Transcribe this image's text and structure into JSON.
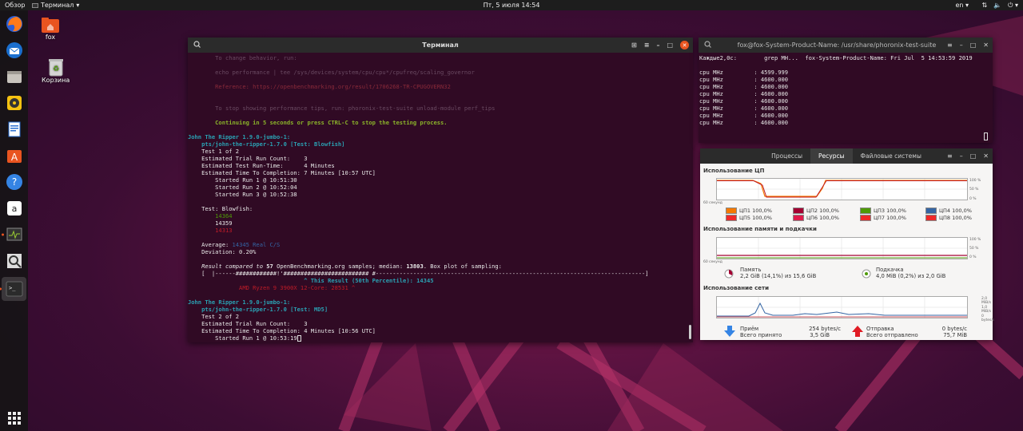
{
  "topbar": {
    "overview": "Обзор",
    "app": "Терминал",
    "clock": "Пт, 5 июля  14:54",
    "lang": "en"
  },
  "desktop": {
    "home_label": "fox",
    "trash_label": "Корзина"
  },
  "terminal": {
    "title": "Терминал",
    "lines": [
      {
        "t": "        To change behavior, run:",
        "c": "dim"
      },
      {
        "t": "",
        "c": ""
      },
      {
        "t": "        echo performance | tee /sys/devices/system/cpu/cpu*/cpufreq/scaling_governor",
        "c": "dim"
      },
      {
        "t": "",
        "c": ""
      },
      {
        "t": "        Reference: https://openbenchmarking.org/result/1706268-TR-CPUGOVERN32",
        "c": "dimred"
      },
      {
        "t": "",
        "c": ""
      },
      {
        "t": "",
        "c": ""
      },
      {
        "t": "        To stop showing performance tips, run: phoronix-test-suite unload-module perf_tips",
        "c": "dim"
      },
      {
        "t": "",
        "c": ""
      },
      {
        "t": "        Continuing in 5 seconds or press CTRL-C to stop the testing process.",
        "c": "green"
      },
      {
        "t": "",
        "c": ""
      },
      {
        "t": "John The Ripper 1.9.0-jumbo-1:",
        "c": "cyanb"
      },
      {
        "t": "    pts/john-the-ripper-1.7.0 [Test: Blowfish]",
        "c": "cyanb"
      },
      {
        "t": "    Test 1 of 2",
        "c": ""
      },
      {
        "t": "    Estimated Trial Run Count:    3",
        "c": ""
      },
      {
        "t": "    Estimated Test Run-Time:      4 Minutes",
        "c": ""
      },
      {
        "t": "    Estimated Time To Completion: 7 Minutes [10:57 UTC]",
        "c": ""
      },
      {
        "t": "        Started Run 1 @ 10:51:30",
        "c": ""
      },
      {
        "t": "        Started Run 2 @ 10:52:04",
        "c": ""
      },
      {
        "t": "        Started Run 3 @ 10:52:38",
        "c": ""
      },
      {
        "t": "",
        "c": ""
      },
      {
        "t": "    Test: Blowfish:",
        "c": ""
      },
      {
        "t": "        14364",
        "c": "green2"
      },
      {
        "t": "        14359",
        "c": ""
      },
      {
        "t": "        14313",
        "c": "red"
      },
      {
        "t": "",
        "c": ""
      },
      {
        "t": "    Average: 14345 Real C/S",
        "c": "avg"
      },
      {
        "t": "    Deviation: 0.20%",
        "c": ""
      },
      {
        "t": "",
        "c": ""
      },
      {
        "t": "    Result compared to 57 OpenBenchmarking.org samples; median: 13803. Box plot of sampling:",
        "c": "cmp"
      },
      {
        "t": "    [  |------############!'######################### #-------------------------------------------------------------------------------]",
        "c": ""
      },
      {
        "t": "                                  ^ This Result (50th Percentile): 14345",
        "c": "cyanb"
      },
      {
        "t": "               AMD Ryzen 9 3900X 12-Core: 28531 ^",
        "c": "red"
      },
      {
        "t": "",
        "c": ""
      },
      {
        "t": "John The Ripper 1.9.0-jumbo-1:",
        "c": "cyanb"
      },
      {
        "t": "    pts/john-the-ripper-1.7.0 [Test: MD5]",
        "c": "cyanb"
      },
      {
        "t": "    Test 2 of 2",
        "c": ""
      },
      {
        "t": "    Estimated Trial Run Count:    3",
        "c": ""
      },
      {
        "t": "    Estimated Time To Completion: 4 Minutes [10:56 UTC]",
        "c": ""
      },
      {
        "t": "        Started Run 1 @ 10:53:19",
        "c": "cursor"
      }
    ]
  },
  "terminal2": {
    "title": "fox@fox-System-Product-Name: /usr/share/phoronix-test-suite",
    "lines": [
      "Каждые2,0с:        grep MH...  fox-System-Product-Name: Fri Jul  5 14:53:59 2019",
      "",
      "cpu MHz         : 4599.999",
      "cpu MHz         : 4600.000",
      "cpu MHz         : 4600.000",
      "cpu MHz         : 4600.000",
      "cpu MHz         : 4600.000",
      "cpu MHz         : 4600.000",
      "cpu MHz         : 4600.000",
      "cpu MHz         : 4600.000"
    ]
  },
  "sysmon": {
    "tabs": [
      "Процессы",
      "Ресурсы",
      "Файловые системы"
    ],
    "active_tab": 1,
    "cpu_title": "Использование ЦП",
    "cpu_legend": [
      {
        "label": "ЦП1  100,0%",
        "color": "#f57900"
      },
      {
        "label": "ЦП2  100,0%",
        "color": "#a40032"
      },
      {
        "label": "ЦП3  100,0%",
        "color": "#4e9a06"
      },
      {
        "label": "ЦП4  100,0%",
        "color": "#3465a4"
      },
      {
        "label": "ЦП5  100,0%",
        "color": "#ef2929"
      },
      {
        "label": "ЦП6  100,0%",
        "color": "#e01b4c"
      },
      {
        "label": "ЦП7  100,0%",
        "color": "#ef2929"
      },
      {
        "label": "ЦП8  100,0%",
        "color": "#ef2929"
      }
    ],
    "mem_title": "Использование памяти и подкачки",
    "mem_label": "Память",
    "mem_value": "2,2 GiB (14,1%) из 15,6 GiB",
    "swap_label": "Подкачка",
    "swap_value": "4,0 MiB (0,2%) из 2,0 GiB",
    "net_title": "Использование сети",
    "recv_label": "Приём",
    "recv_rate": "254 bytes/c",
    "recv_total_label": "Всего принято",
    "recv_total": "3,5 GiB",
    "send_label": "Отправка",
    "send_rate": "0 bytes/c",
    "send_total_label": "Всего отправлено",
    "send_total": "75,7 MiB",
    "axis": {
      "sec60": "60 секунд",
      "p100": "100 %",
      "p50": "50 %",
      "p0": "0 %",
      "n2": "2,0 MiB/s",
      "n1": "1,0 MiB/s",
      "n0": "0 bytes/s"
    },
    "colors": {
      "cpu_line": "#f57900",
      "mem_line": "#a40032",
      "swap_line": "#4e9a06",
      "net_line": "#3465a4"
    }
  }
}
